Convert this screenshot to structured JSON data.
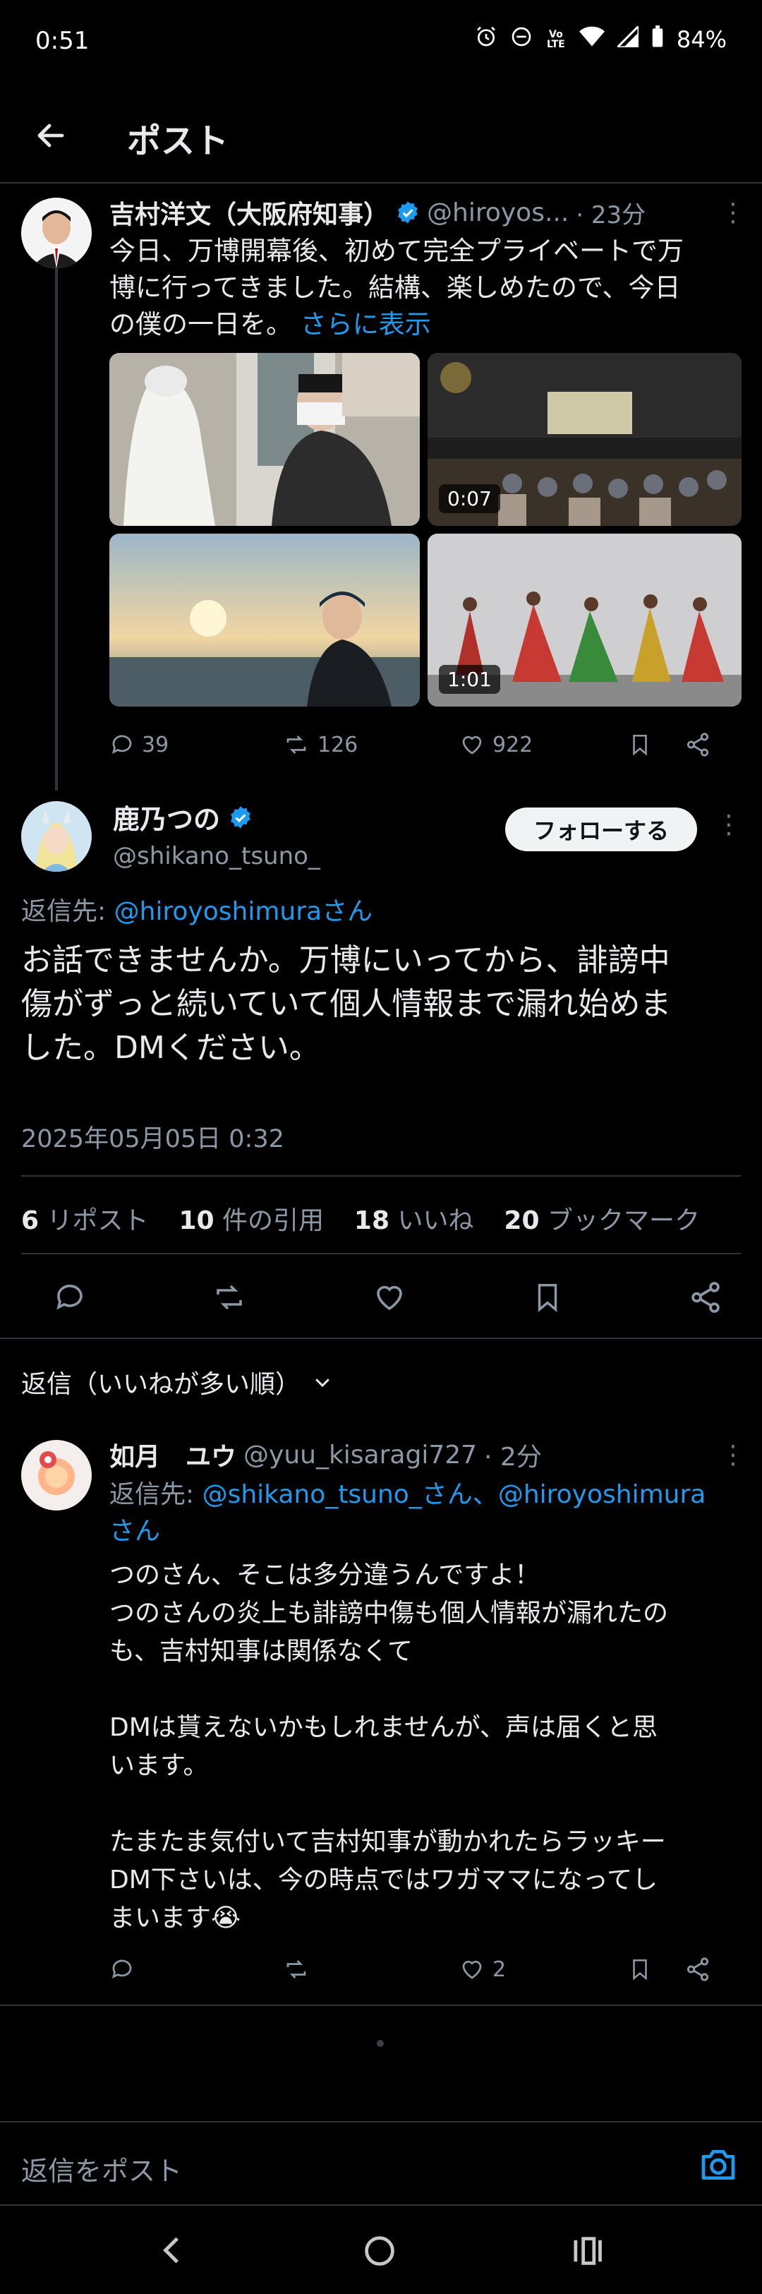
{
  "status_bar": {
    "time": "0:51",
    "battery": "84%",
    "volte": "Vo LTE"
  },
  "header": {
    "title": "ポスト"
  },
  "parent_post": {
    "author_name": "吉村洋文（大阪府知事）",
    "handle": "@hiroyos...",
    "time": "· 23分",
    "text_line1": "今日、万博開幕後、初めて完全プライベートで万",
    "text_line2": "博に行ってきました。結構、楽しめたので、今日",
    "text_line3": "の僕の一日を。",
    "show_more": "さらに表示",
    "media": [
      {
        "icon": "photo-people"
      },
      {
        "icon": "video-hall",
        "duration": "0:07"
      },
      {
        "icon": "photo-sunset-selfie"
      },
      {
        "icon": "video-dancers",
        "duration": "1:01"
      }
    ],
    "actions": {
      "replies": "39",
      "reposts": "126",
      "likes": "922"
    }
  },
  "main_post": {
    "author_name": "鹿乃つの",
    "handle": "@shikano_tsuno_",
    "follow_label": "フォローする",
    "reply_to_label": "返信先: ",
    "reply_to_handle": "@hiroyoshimuraさん",
    "text_line1": "お話できませんか。万博にいってから、誹謗中",
    "text_line2": "傷がずっと続いていて個人情報まで漏れ始めま",
    "text_line3": "した。DMください。",
    "timestamp": "2025年05月05日 0:32",
    "stats": {
      "reposts_num": "6",
      "reposts_label": "リポスト",
      "quotes_num": "10",
      "quotes_label": "件の引用",
      "likes_num": "18",
      "likes_label": "いいね",
      "bookmarks_num": "20",
      "bookmarks_label": "ブックマーク"
    }
  },
  "replies_section": {
    "sort_label": "返信（いいねが多い順）"
  },
  "reply": {
    "author_name": "如月　ユウ",
    "handle": "@yuu_kisaragi727",
    "time": "· 2分",
    "reply_to_label": "返信先: ",
    "reply_to_handle1": "@shikano_tsuno_さん",
    "reply_to_sep": "、",
    "reply_to_handle2": "@hiroyoshimura",
    "reply_to_suffix": "さん",
    "lines": [
      "つのさん、そこは多分違うんですよ！",
      "つのさんの炎上も誹謗中傷も個人情報が漏れたの",
      "も、吉村知事は関係なくて",
      "",
      "DMは貰えないかもしれませんが、声は届くと思",
      "います。",
      "",
      "たまたま気付いて吉村知事が動かれたらラッキー",
      "DM下さいは、今の時点ではワガママになってし",
      "まいます😭"
    ],
    "actions": {
      "likes": "2"
    }
  },
  "compose": {
    "placeholder": "返信をポスト"
  },
  "colors": {
    "accent": "#1d9bf0",
    "background": "#000000",
    "muted": "#8b98a5",
    "divider": "#2f3336"
  }
}
